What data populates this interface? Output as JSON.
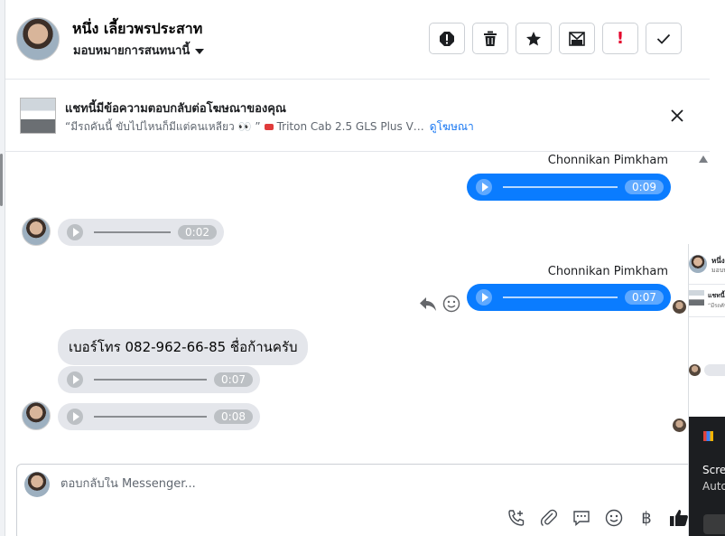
{
  "header": {
    "contact_name": "หนึ่ง เลี้ยวพรประสาท",
    "assign_label": "มอบหมายการสนทนานี้",
    "actions": [
      {
        "name": "spam-icon"
      },
      {
        "name": "trash-icon"
      },
      {
        "name": "star-icon"
      },
      {
        "name": "mark-unread-icon"
      },
      {
        "name": "follow-up-icon",
        "glyph": "!"
      },
      {
        "name": "done-check-icon"
      }
    ],
    "colors": {
      "follow_up": "#e4002b"
    }
  },
  "banner": {
    "title": "แชทนี้มีข้อความตอบกลับต่อโฆษณาของคุณ",
    "quote": "“มีรถคันนี้ ขับไปไหนก็มีแต่คนเหลียว 👀 ”",
    "product": "Triton Cab 2.5 GLS Plus V…",
    "link": "ดูโฆษณา"
  },
  "thread": {
    "messages": [
      {
        "type": "audio",
        "direction": "out",
        "sender": "Chonnikan Pimkham",
        "duration": "0:09"
      },
      {
        "type": "audio",
        "direction": "in",
        "duration": "0:02"
      },
      {
        "type": "audio",
        "direction": "out",
        "sender": "Chonnikan Pimkham",
        "duration": "0:07"
      },
      {
        "type": "text",
        "direction": "in",
        "text": "เบอร์โทร 082-962-66-85 ชื่อก้านครับ"
      },
      {
        "type": "audio",
        "direction": "in",
        "duration": "0:07"
      },
      {
        "type": "audio",
        "direction": "in",
        "duration": "0:08"
      }
    ],
    "colors": {
      "outgoing": "#0a7cff",
      "incoming": "#e4e6eb"
    }
  },
  "composer": {
    "placeholder": "ตอบกลับใน Messenger...",
    "tools": [
      {
        "name": "call-add-icon"
      },
      {
        "name": "attachment-icon"
      },
      {
        "name": "saved-reply-icon"
      },
      {
        "name": "emoji-icon"
      },
      {
        "name": "baht-payment-icon",
        "glyph": "฿"
      },
      {
        "name": "thumbs-up-icon"
      }
    ]
  },
  "overlay": {
    "mini_name": "หนึ่ง",
    "mini_sub": "มอบหม",
    "mini_title": "แชทนี้",
    "mini_sub2": "“มีรถคัน",
    "toast_line1": "Scre",
    "toast_line2": "Auto"
  }
}
